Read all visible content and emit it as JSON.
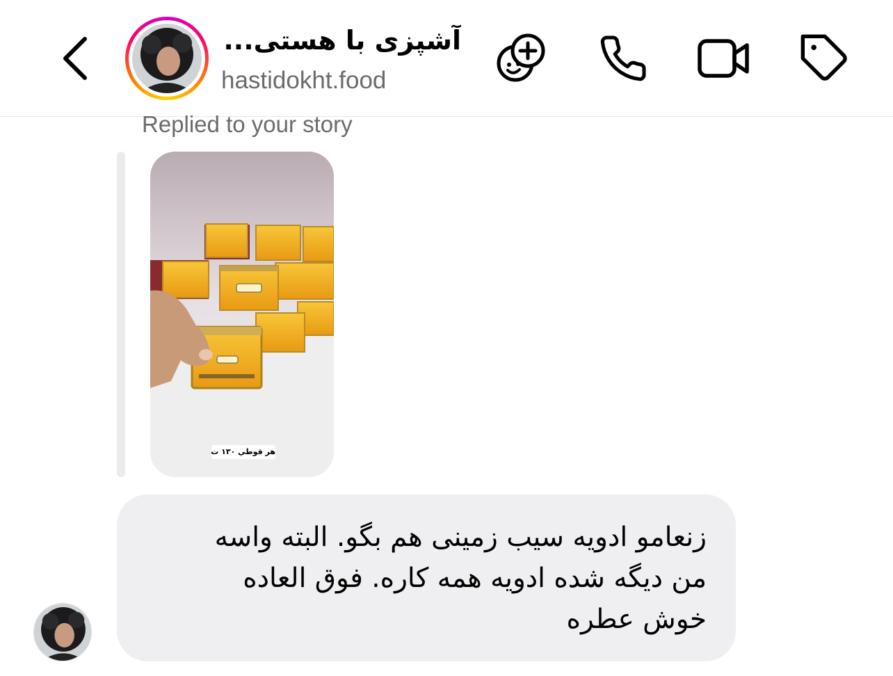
{
  "header": {
    "title": "آشپزی با هستی...",
    "handle": "hastidokht.food",
    "icons": [
      "chevron-left-icon",
      "add-sticker-icon",
      "phone-icon",
      "video-camera-icon",
      "tag-icon"
    ]
  },
  "thread": {
    "replied_label": "Replied to your story",
    "story": {
      "overlay_text": "هر قوطي ١٣٠ ت"
    },
    "message": {
      "lines": [
        "زنعامو ادویه سیب زمینی هم بگو. البته واسه",
        "من دیگه شده ادویه همه کاره. فوق العاده",
        "خوش عطره"
      ]
    }
  },
  "colors": {
    "bubble": "#efeff1",
    "secondary_text": "#6b6b6b",
    "story_ring": [
      "#d300c5",
      "#ff0069",
      "#ff7a00",
      "#ffd600"
    ]
  }
}
